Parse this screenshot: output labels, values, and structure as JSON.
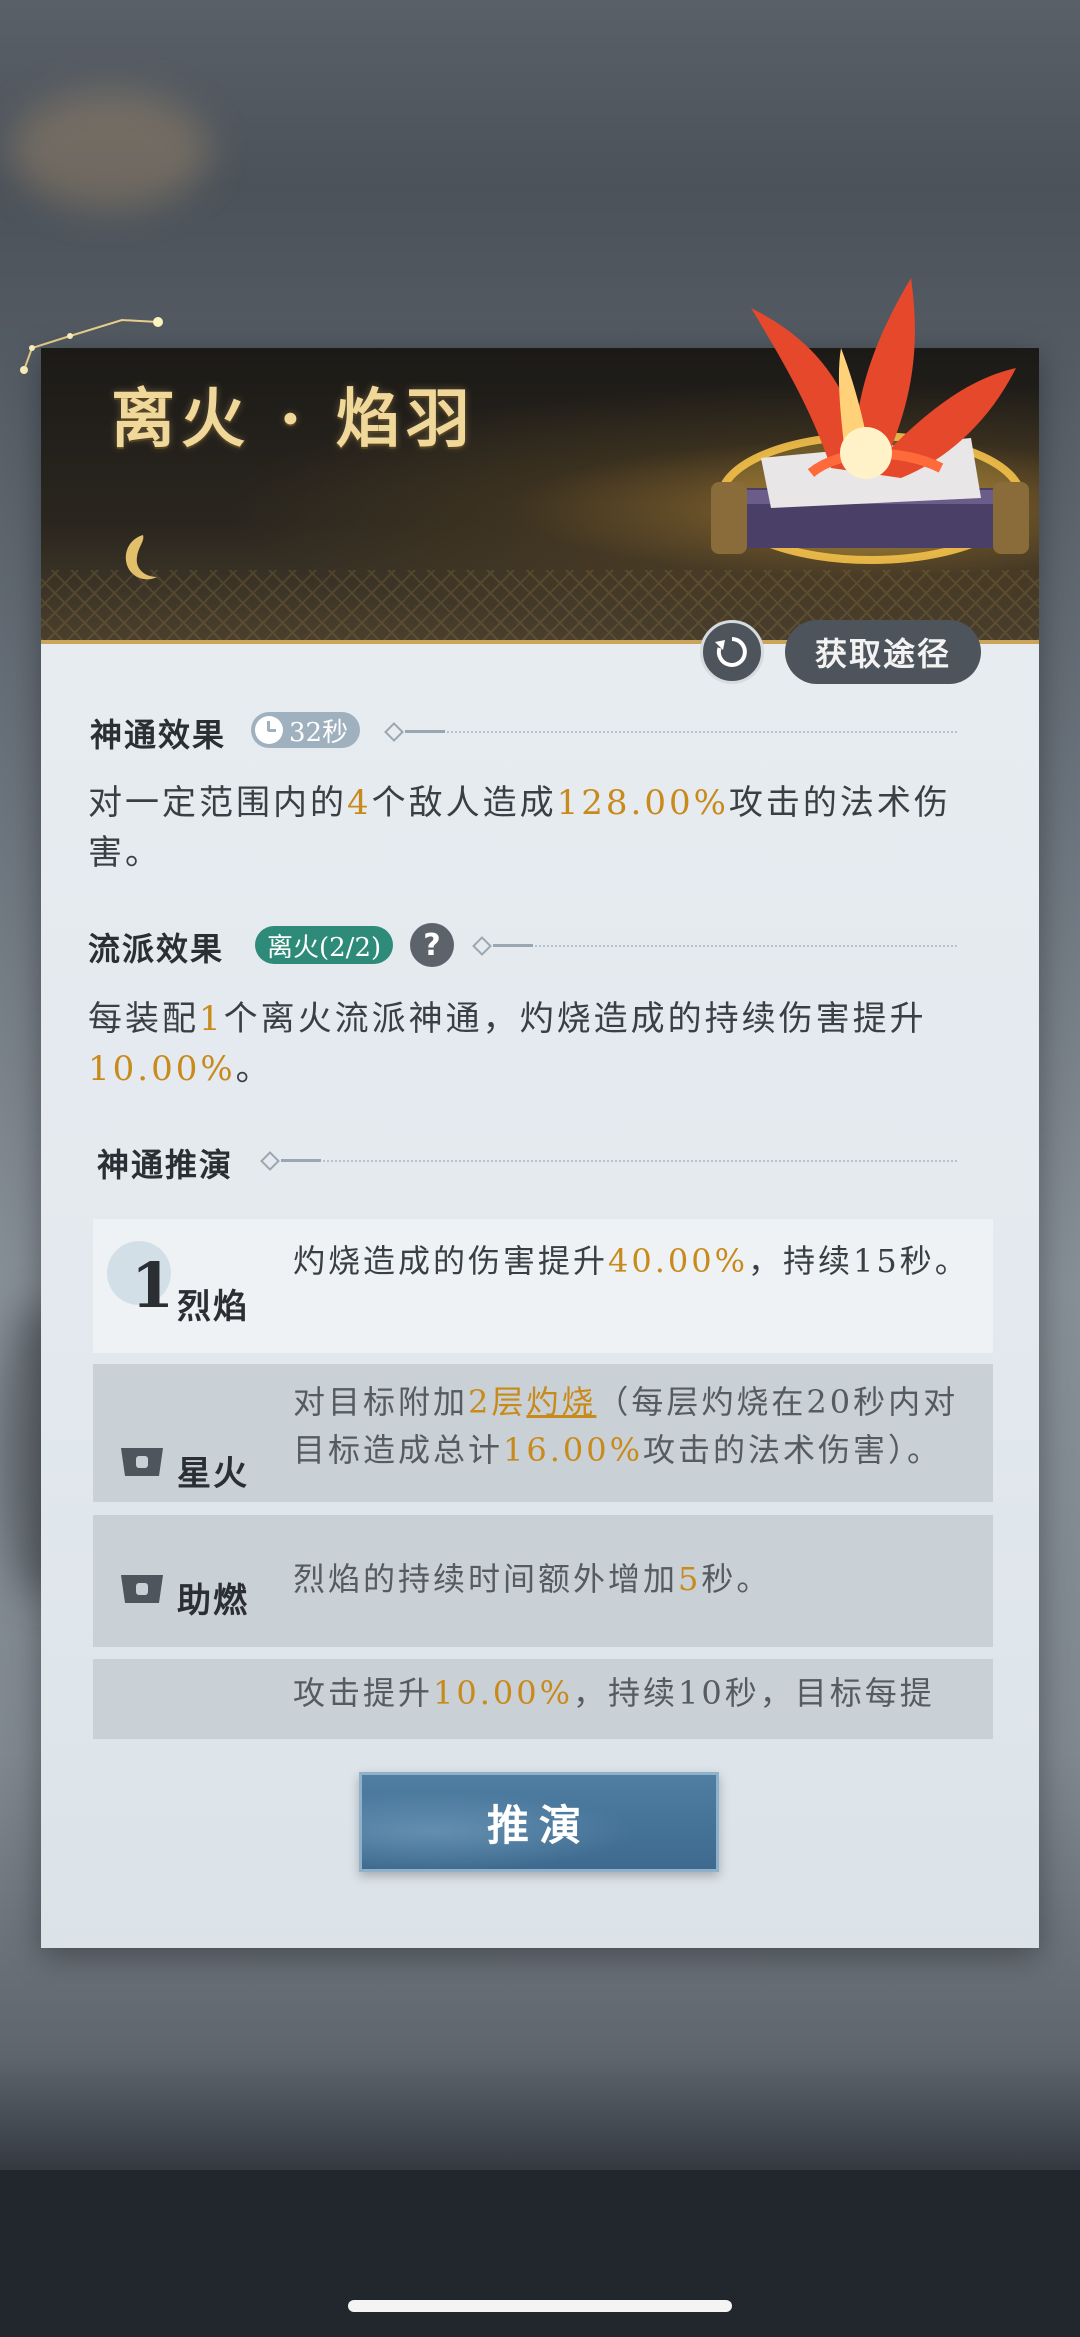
{
  "skill": {
    "name": "离火 · 焰羽",
    "source_button": "获取途径"
  },
  "effect": {
    "title": "神通效果",
    "cooldown": "32秒",
    "desc_parts": [
      "对一定范围内的",
      "4",
      "个敌人造成",
      "128.00%",
      "攻击的法术伤害。"
    ]
  },
  "school": {
    "title": "流派效果",
    "badge": "离火(2/2)",
    "help": "?",
    "desc_parts": [
      "每装配",
      "1",
      "个离火流派神通，灼烧造成的持续伤害提升",
      "10.00%",
      "。"
    ]
  },
  "evolution": {
    "title": "神通推演",
    "items": [
      {
        "level": "1",
        "name": "烈焰",
        "state": "unlocked",
        "text_parts": [
          "灼烧造成的伤害提升",
          "40.00%",
          "，持续15秒。"
        ]
      },
      {
        "name": "星火",
        "state": "locked",
        "text_parts": [
          "对目标附加",
          "2层",
          "灼烧",
          "（每层灼烧在20秒内对目标造成总计",
          "16.00%",
          "攻击的法术伤害）。"
        ]
      },
      {
        "name": "助燃",
        "state": "locked",
        "text_parts": [
          "烈焰的持续时间额外增加",
          "5",
          "秒。"
        ]
      },
      {
        "name": "",
        "state": "locked",
        "text_parts": [
          "攻击提升",
          "10.00%",
          "，持续10秒，目标每提"
        ]
      }
    ],
    "button": "推演"
  },
  "colors": {
    "highlight": "#c98a1c",
    "school_badge": "#2e8a79",
    "header_gold": "#f0d89a",
    "button_blue": "#3d6a8e"
  },
  "icons": [
    "moon-icon",
    "refresh-icon",
    "clock-icon",
    "help-icon",
    "lock-icon",
    "phoenix-scroll-artwork"
  ]
}
